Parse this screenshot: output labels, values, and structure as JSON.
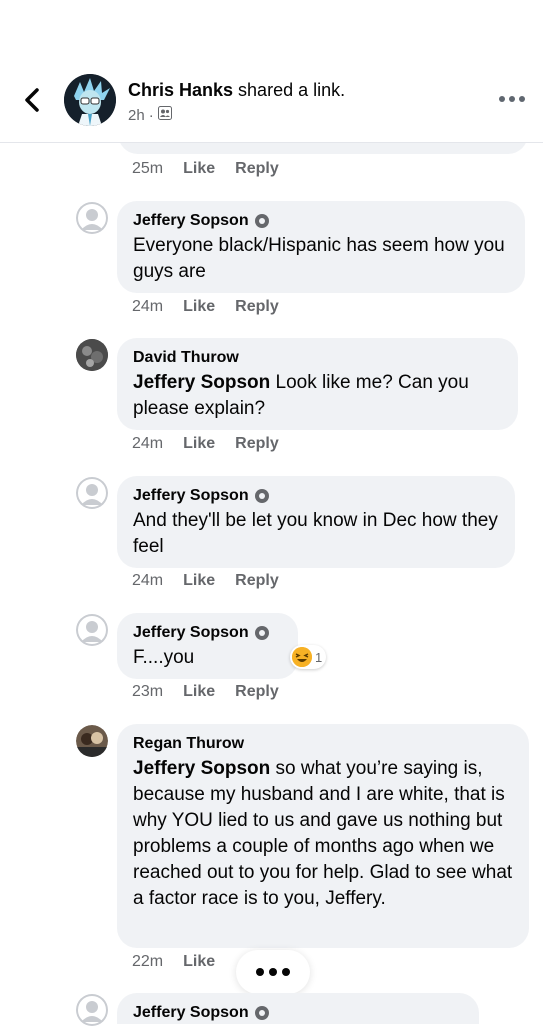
{
  "header": {
    "poster_name": "Chris Hanks",
    "action_text": " shared a link.",
    "time": "2h",
    "separator": "·"
  },
  "comments": [
    {
      "author": "Jeffery Sopson",
      "text": "Everyone black/Hispanic has seem how you guys are",
      "time": "24m",
      "like": "Like",
      "reply": "Reply"
    },
    {
      "author": "David Thurow",
      "mention": "Jeffery Sopson",
      "text": " Look like me? Can you please explain?",
      "time": "24m",
      "like": "Like",
      "reply": "Reply"
    },
    {
      "author": "Jeffery Sopson",
      "text": "And they'll be let you know in Dec how they feel",
      "time": "24m",
      "like": "Like",
      "reply": "Reply"
    },
    {
      "author": "Jeffery Sopson",
      "text": "F....you",
      "reaction_count": "1",
      "time": "23m",
      "like": "Like",
      "reply": "Reply"
    },
    {
      "author": "Regan Thurow",
      "mention": "Jeffery Sopson",
      "text": " so what you’re saying is, because my husband and I are white, that is why YOU lied to us and gave us nothing but problems a couple of months ago when we reached out to you for help. Glad to see what a factor race is to you, Jeffery.",
      "time": "22m",
      "like": "Like"
    },
    {
      "author": "Jeffery Sopson"
    }
  ],
  "previous_comment": {
    "time": "25m",
    "like": "Like",
    "reply": "Reply"
  },
  "colors": {
    "bubble": "#f0f2f5",
    "meta": "#65676b",
    "text": "#050505"
  },
  "icons": [
    "back-arrow-icon",
    "audience-friends-icon",
    "more-options-icon",
    "verified-badge-icon",
    "laughing-reaction-icon",
    "loading-dots-icon"
  ]
}
